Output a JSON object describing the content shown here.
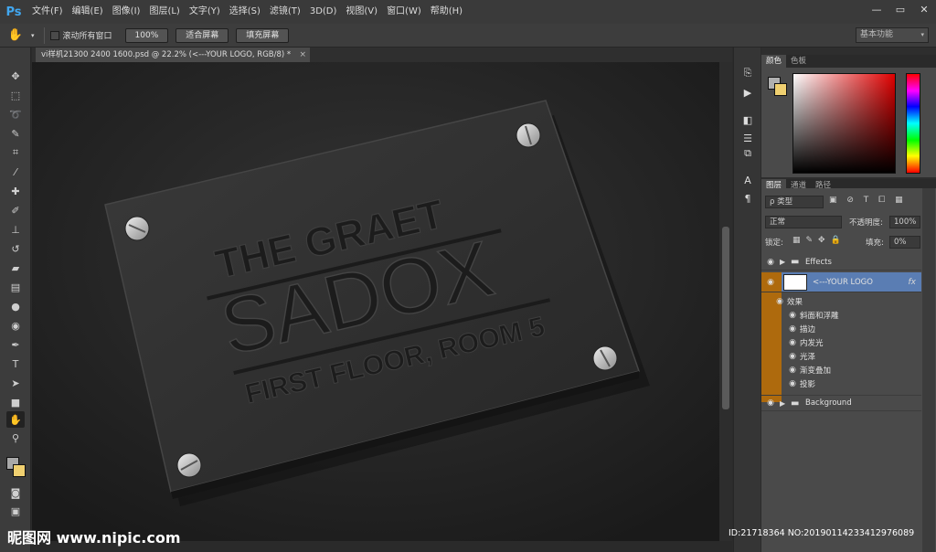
{
  "app": {
    "logo": "Ps",
    "accent": "#41a7f0"
  },
  "menu": [
    "文件(F)",
    "编辑(E)",
    "图像(I)",
    "图层(L)",
    "文字(Y)",
    "选择(S)",
    "滤镜(T)",
    "3D(D)",
    "视图(V)",
    "窗口(W)",
    "帮助(H)"
  ],
  "window_controls": {
    "minimize": "—",
    "restore": "▭",
    "close": "✕"
  },
  "options": {
    "scroll_all": "滚动所有窗口",
    "btn_100": "100%",
    "btn_fit": "适合屏幕",
    "btn_fill": "填充屏幕",
    "workspace": "基本功能"
  },
  "document": {
    "tab_title": "vi样机21300 2400 1600.psd @ 22.2% (<---YOUR LOGO, RGB/8) *",
    "close": "×",
    "plate": {
      "line1": "THE GRAET",
      "line2": "SADOX",
      "line3": "FIRST FLOOR, ROOM 5"
    }
  },
  "color_panel": {
    "tabs": [
      "颜色",
      "色板"
    ],
    "fg": "#b0b0b0",
    "bg": "#f0d070"
  },
  "layers_panel": {
    "tabs": [
      "图层",
      "通道",
      "路径"
    ],
    "filter": "ρ 类型",
    "blend_mode": "正常",
    "opacity_label": "不透明度:",
    "opacity_value": "100%",
    "lock_label": "锁定:",
    "fill_label": "填充:",
    "fill_value": "0%",
    "layers": [
      {
        "name": "Effects",
        "type": "group"
      },
      {
        "name": "<---YOUR LOGO",
        "type": "layer",
        "selected": true,
        "fx": "fx"
      },
      {
        "name": "效果",
        "type": "effects-header"
      },
      {
        "name": "斜面和浮雕",
        "type": "effect"
      },
      {
        "name": "描边",
        "type": "effect"
      },
      {
        "name": "内发光",
        "type": "effect"
      },
      {
        "name": "光泽",
        "type": "effect"
      },
      {
        "name": "渐变叠加",
        "type": "effect"
      },
      {
        "name": "投影",
        "type": "effect"
      },
      {
        "name": "Background",
        "type": "group"
      }
    ]
  },
  "watermark": {
    "left": "昵图网 www.nipic.com",
    "right": "ID:21718364 NO:20190114233412976089"
  }
}
